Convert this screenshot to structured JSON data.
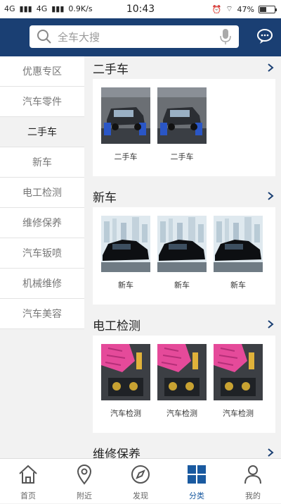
{
  "status_bar": {
    "network_1": "4G",
    "network_2": "4G",
    "speed": "0.9K/s",
    "time": "10:43",
    "battery_level": 0.47,
    "battery": "47%"
  },
  "header": {
    "search_placeholder": "全车大搜"
  },
  "sidebar": {
    "items": [
      {
        "label": "优惠专区"
      },
      {
        "label": "汽车零件"
      },
      {
        "label": "二手车"
      },
      {
        "label": "新车"
      },
      {
        "label": "电工检测"
      },
      {
        "label": "维修保养"
      },
      {
        "label": "汽车钣喷"
      },
      {
        "label": "机械维修"
      },
      {
        "label": "汽车美容"
      }
    ],
    "active_index": 2
  },
  "sections": [
    {
      "title": "二手车",
      "items": [
        "二手车",
        "二手车"
      ],
      "thumb_type": "used-car"
    },
    {
      "title": "新车",
      "items": [
        "新车",
        "新车",
        "新车"
      ],
      "thumb_type": "new-car"
    },
    {
      "title": "电工检测",
      "items": [
        "汽车检测",
        "汽车检测",
        "汽车检测"
      ],
      "thumb_type": "inspection"
    },
    {
      "title": "维修保养",
      "items": [],
      "thumb_type": ""
    }
  ],
  "tabbar": {
    "items": [
      {
        "label": "首页",
        "icon": "home-icon"
      },
      {
        "label": "附近",
        "icon": "location-icon"
      },
      {
        "label": "发现",
        "icon": "compass-icon"
      },
      {
        "label": "分类",
        "icon": "grid-icon"
      },
      {
        "label": "我的",
        "icon": "user-icon"
      }
    ],
    "active_index": 3
  },
  "colors": {
    "header_bg": "#1a3f73",
    "accent": "#1a5aa0"
  }
}
